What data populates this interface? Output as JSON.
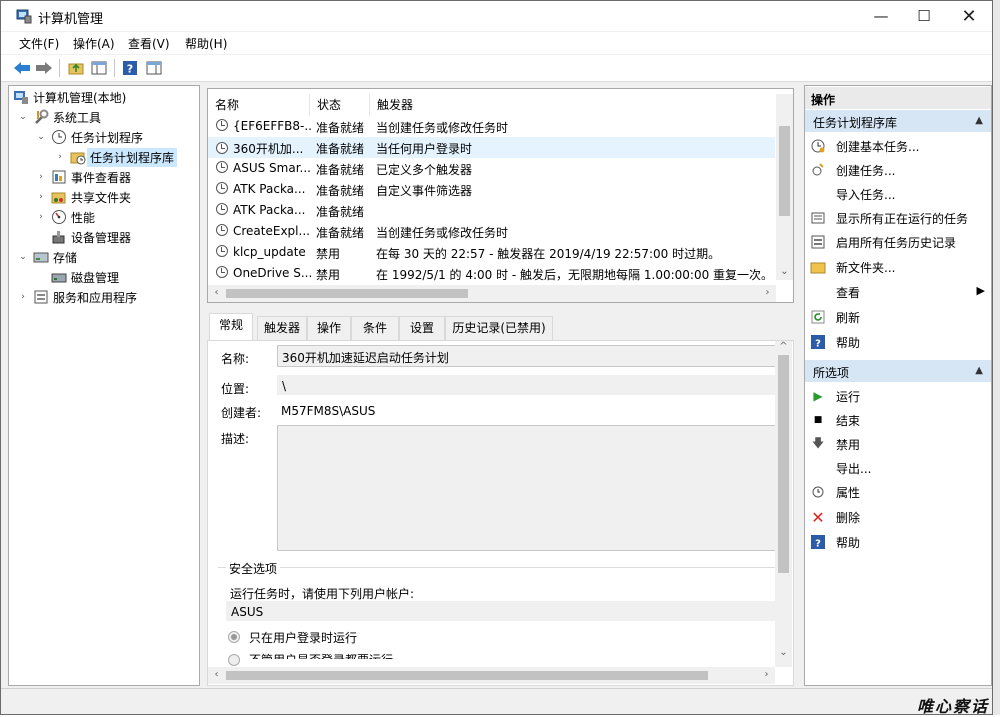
{
  "window": {
    "title": "计算机管理"
  },
  "menu": [
    "文件(F)",
    "操作(A)",
    "查看(V)",
    "帮助(H)"
  ],
  "tree": [
    {
      "label": "计算机管理(本地)",
      "expander": "",
      "icon": "computer-management-icon"
    },
    {
      "label": "系统工具",
      "expander": "⌄",
      "icon": "system-tools-icon"
    },
    {
      "label": "任务计划程序",
      "expander": "⌄",
      "icon": "task-scheduler-icon"
    },
    {
      "label": "任务计划程序库",
      "expander": "›",
      "icon": "folder-icon",
      "selected": true
    },
    {
      "label": "事件查看器",
      "expander": "›",
      "icon": "event-viewer-icon"
    },
    {
      "label": "共享文件夹",
      "expander": "›",
      "icon": "shared-folders-icon"
    },
    {
      "label": "性能",
      "expander": "›",
      "icon": "performance-icon"
    },
    {
      "label": "设备管理器",
      "expander": "",
      "icon": "device-manager-icon"
    },
    {
      "label": "存储",
      "expander": "⌄",
      "icon": "storage-icon"
    },
    {
      "label": "磁盘管理",
      "expander": "",
      "icon": "disk-management-icon"
    },
    {
      "label": "服务和应用程序",
      "expander": "›",
      "icon": "services-apps-icon"
    }
  ],
  "task_list": {
    "columns": [
      "名称",
      "状态",
      "触发器"
    ],
    "rows": [
      {
        "name": "{EF6EFFB8-...",
        "status": "准备就绪",
        "trigger": "当创建任务或修改任务时"
      },
      {
        "name": "360开机加...",
        "status": "准备就绪",
        "trigger": "当任何用户登录时",
        "selected": true
      },
      {
        "name": "ASUS Smar...",
        "status": "准备就绪",
        "trigger": "已定义多个触发器"
      },
      {
        "name": "ATK Packa...",
        "status": "准备就绪",
        "trigger": "自定义事件筛选器"
      },
      {
        "name": "ATK Packa...",
        "status": "准备就绪",
        "trigger": ""
      },
      {
        "name": "CreateExpl...",
        "status": "准备就绪",
        "trigger": "当创建任务或修改任务时"
      },
      {
        "name": "klcp_update",
        "status": "禁用",
        "trigger": "在每 30 天的 22:57 - 触发器在 2019/4/19 22:57:00 时过期。"
      },
      {
        "name": "OneDrive S...",
        "status": "禁用",
        "trigger": "在 1992/5/1 的 4:00 时 - 触发后，无限期地每隔 1.00:00:00 重复一次。"
      }
    ]
  },
  "tabs": [
    "常规",
    "触发器",
    "操作",
    "条件",
    "设置",
    "历史记录(已禁用)"
  ],
  "general": {
    "name_label": "名称:",
    "name_value": "360开机加速延迟启动任务计划",
    "location_label": "位置:",
    "location_value": "\\",
    "author_label": "创建者:",
    "author_value": "M57FM8S\\ASUS",
    "desc_label": "描述:",
    "security_title": "安全选项",
    "run_as_label": "运行任务时，请使用下列用户帐户:",
    "run_as_value": "ASUS",
    "radio1": "只在用户登录时运行",
    "radio2": "不管用户是否登录都要运行"
  },
  "actions": {
    "title": "操作",
    "section1": "任务计划程序库",
    "items1": [
      {
        "label": "创建基本任务...",
        "icon": "create-basic-task-icon"
      },
      {
        "label": "创建任务...",
        "icon": "create-task-icon"
      },
      {
        "label": "导入任务...",
        "icon": ""
      },
      {
        "label": "显示所有正在运行的任务",
        "icon": "running-tasks-icon"
      },
      {
        "label": "启用所有任务历史记录",
        "icon": "history-icon"
      },
      {
        "label": "新文件夹...",
        "icon": "new-folder-icon"
      },
      {
        "label": "查看",
        "icon": "",
        "submenu": true
      },
      {
        "label": "刷新",
        "icon": "refresh-icon"
      },
      {
        "label": "帮助",
        "icon": "help-icon"
      }
    ],
    "section2": "所选项",
    "items2": [
      {
        "label": "运行",
        "icon": "run-icon"
      },
      {
        "label": "结束",
        "icon": "end-icon"
      },
      {
        "label": "禁用",
        "icon": "disable-icon"
      },
      {
        "label": "导出...",
        "icon": ""
      },
      {
        "label": "属性",
        "icon": "properties-icon"
      },
      {
        "label": "删除",
        "icon": "delete-icon"
      },
      {
        "label": "帮助",
        "icon": "help-icon"
      }
    ]
  },
  "watermark": "唯心察话"
}
